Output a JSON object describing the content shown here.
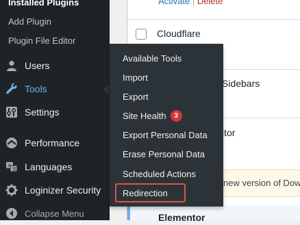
{
  "sidebar": {
    "installed_plugins": "Installed Plugins",
    "add_plugin": "Add Plugin",
    "plugin_file_editor": "Plugin File Editor",
    "users": "Users",
    "tools": "Tools",
    "settings": "Settings",
    "performance": "Performance",
    "languages": "Languages",
    "loginizer_security": "Loginizer Security",
    "collapse_menu": "Collapse Menu"
  },
  "flyout": {
    "items": [
      {
        "label": "Available Tools"
      },
      {
        "label": "Import"
      },
      {
        "label": "Export"
      },
      {
        "label": "Site Health",
        "badge": "3"
      },
      {
        "label": "Export Personal Data"
      },
      {
        "label": "Erase Personal Data"
      },
      {
        "label": "Scheduled Actions"
      },
      {
        "label": "Redirection"
      }
    ]
  },
  "content": {
    "row_actions": {
      "activate": "Activate",
      "separator": "|",
      "delete": "Delete"
    },
    "plugin_cloudflare": "Cloudflare",
    "partial_sidebars": "Sidebars",
    "partial_editor": "itor",
    "notice_text": "new version of Dow",
    "plugin_elementor": "Elementor"
  },
  "colors": {
    "sidebar_bg": "#1d2327",
    "flyout_bg": "#2c3338",
    "active_blue": "#72aee6",
    "badge_red": "#d63638",
    "highlight_red": "#e2514c"
  },
  "icons": {
    "users": "users-icon",
    "tools": "wrench-icon",
    "settings": "settings-sliders-icon",
    "performance": "performance-icon",
    "languages": "translate-icon",
    "loginizer": "gear-icon",
    "collapse": "collapse-arrow-icon"
  }
}
